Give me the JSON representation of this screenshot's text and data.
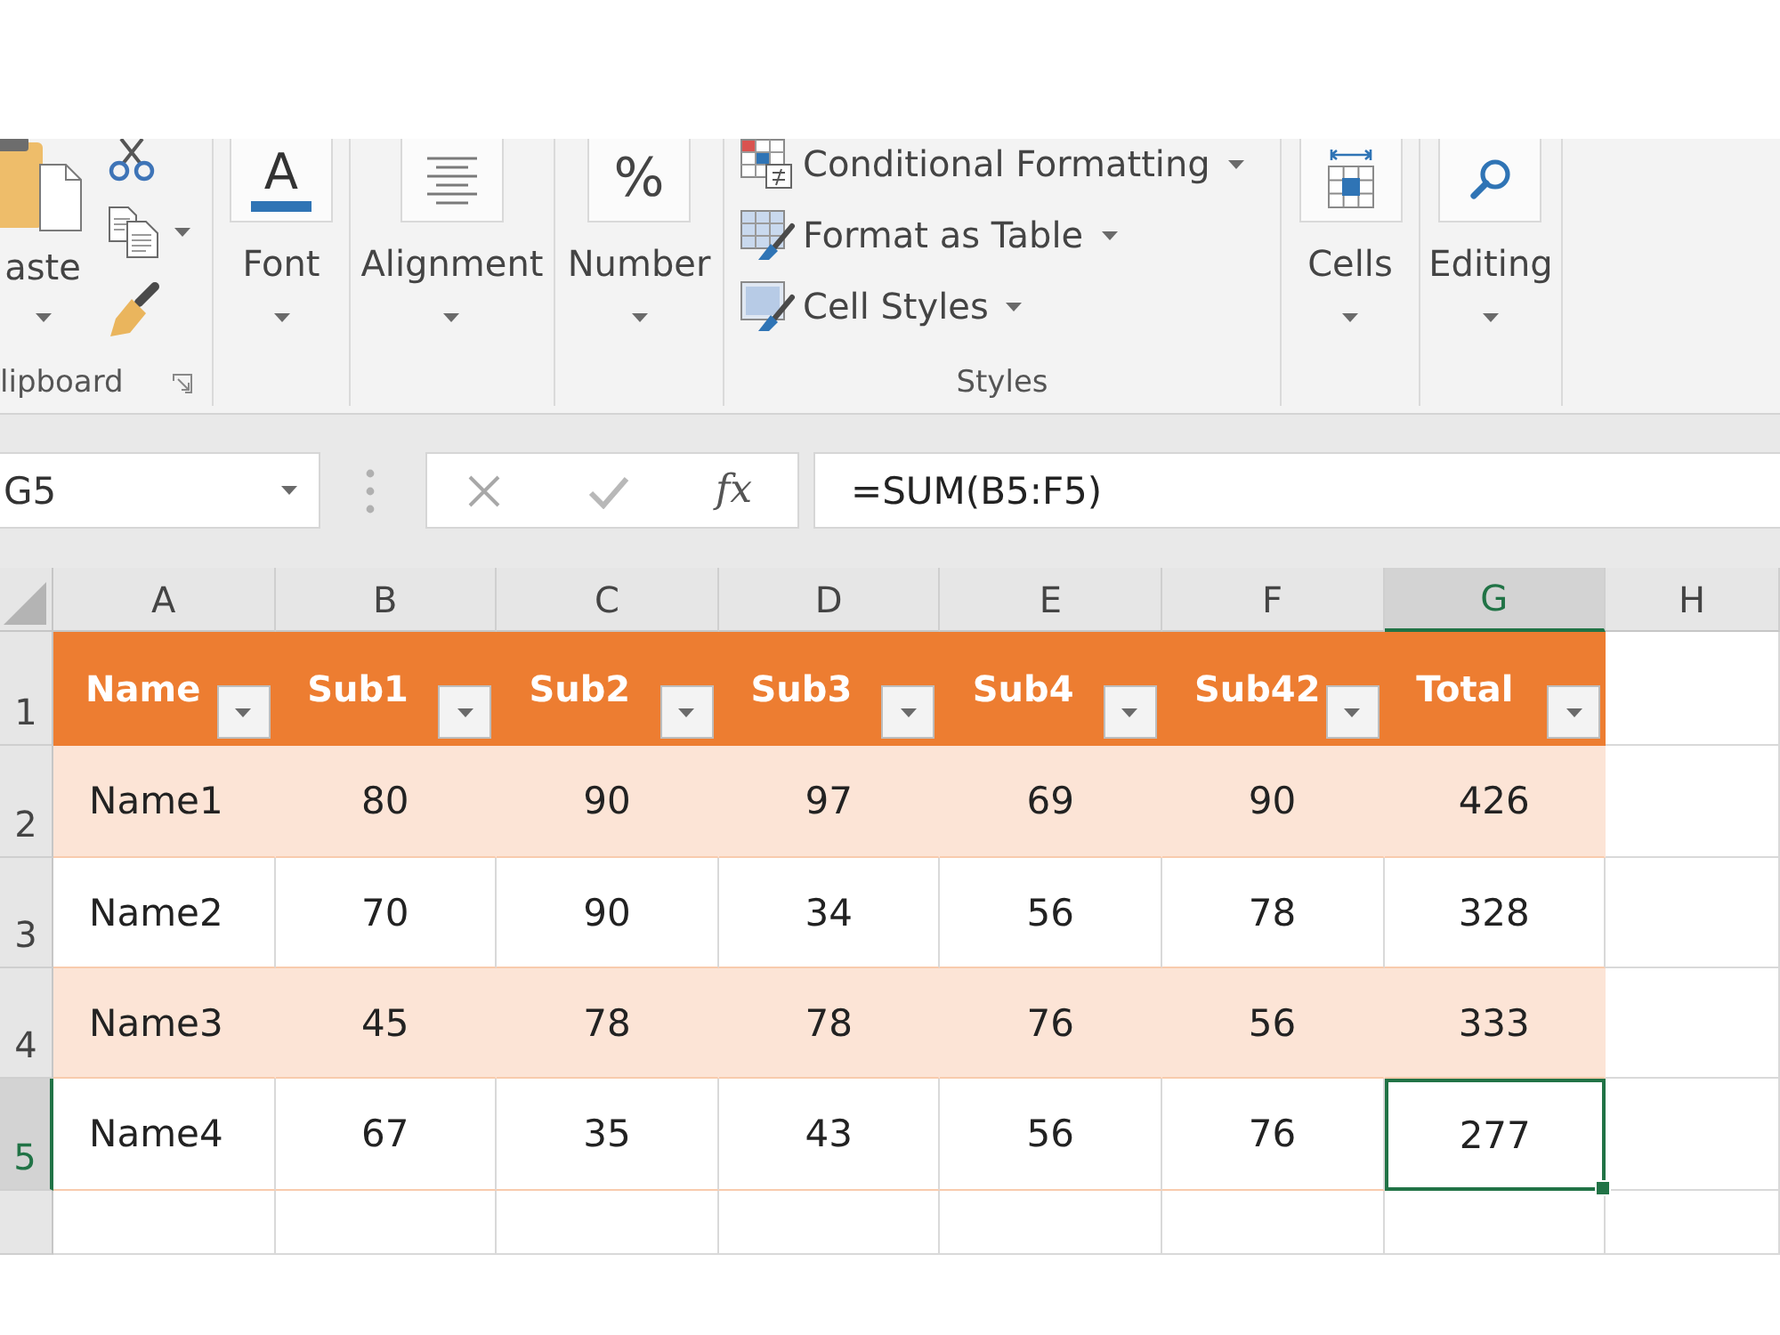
{
  "ribbon": {
    "groups": [
      {
        "kind": "clipboard",
        "paste_label": "aste",
        "group_label": "lipboard"
      },
      {
        "kind": "font",
        "glyph": "A",
        "label": "Font"
      },
      {
        "kind": "alignment",
        "label": "Alignment"
      },
      {
        "kind": "number",
        "glyph": "%",
        "label": "Number"
      },
      {
        "kind": "styles",
        "items": [
          {
            "kind": "conditional",
            "label": "Conditional Formatting"
          },
          {
            "kind": "table",
            "label": "Format as Table"
          },
          {
            "kind": "cellstyles",
            "label": "Cell Styles"
          }
        ],
        "group_label": "Styles"
      },
      {
        "kind": "cells",
        "label": "Cells"
      },
      {
        "kind": "editing",
        "label": "Editing"
      }
    ]
  },
  "formula_bar": {
    "name_box": "G5",
    "function_label": "fx",
    "formula": "=SUM(B5:F5)"
  },
  "sheet": {
    "columns": [
      {
        "label": "A",
        "selected": false
      },
      {
        "label": "B",
        "selected": false
      },
      {
        "label": "C",
        "selected": false
      },
      {
        "label": "D",
        "selected": false
      },
      {
        "label": "E",
        "selected": false
      },
      {
        "label": "F",
        "selected": false
      },
      {
        "label": "G",
        "selected": true
      },
      {
        "label": "H",
        "selected": false
      }
    ],
    "row_headers": [
      {
        "label": "1",
        "selected": false
      },
      {
        "label": "2",
        "selected": false
      },
      {
        "label": "3",
        "selected": false
      },
      {
        "label": "4",
        "selected": false
      },
      {
        "label": "5",
        "selected": true
      }
    ],
    "table": {
      "headers": [
        "Name",
        "Sub1",
        "Sub2",
        "Sub3",
        "Sub4",
        "Sub42",
        "Total"
      ],
      "rows": [
        {
          "cells": [
            {
              "text": "Name1",
              "selected": false
            },
            {
              "text": "80",
              "selected": false
            },
            {
              "text": "90",
              "selected": false
            },
            {
              "text": "97",
              "selected": false
            },
            {
              "text": "69",
              "selected": false
            },
            {
              "text": "90",
              "selected": false
            },
            {
              "text": "426",
              "selected": false
            }
          ]
        },
        {
          "cells": [
            {
              "text": "Name2",
              "selected": false
            },
            {
              "text": "70",
              "selected": false
            },
            {
              "text": "90",
              "selected": false
            },
            {
              "text": "34",
              "selected": false
            },
            {
              "text": "56",
              "selected": false
            },
            {
              "text": "78",
              "selected": false
            },
            {
              "text": "328",
              "selected": false
            }
          ]
        },
        {
          "cells": [
            {
              "text": "Name3",
              "selected": false
            },
            {
              "text": "45",
              "selected": false
            },
            {
              "text": "78",
              "selected": false
            },
            {
              "text": "78",
              "selected": false
            },
            {
              "text": "76",
              "selected": false
            },
            {
              "text": "56",
              "selected": false
            },
            {
              "text": "333",
              "selected": false
            }
          ]
        },
        {
          "cells": [
            {
              "text": "Name4",
              "selected": false
            },
            {
              "text": "67",
              "selected": false
            },
            {
              "text": "35",
              "selected": false
            },
            {
              "text": "43",
              "selected": false
            },
            {
              "text": "56",
              "selected": false
            },
            {
              "text": "76",
              "selected": false
            },
            {
              "text": "277",
              "selected": true
            }
          ]
        }
      ]
    }
  }
}
